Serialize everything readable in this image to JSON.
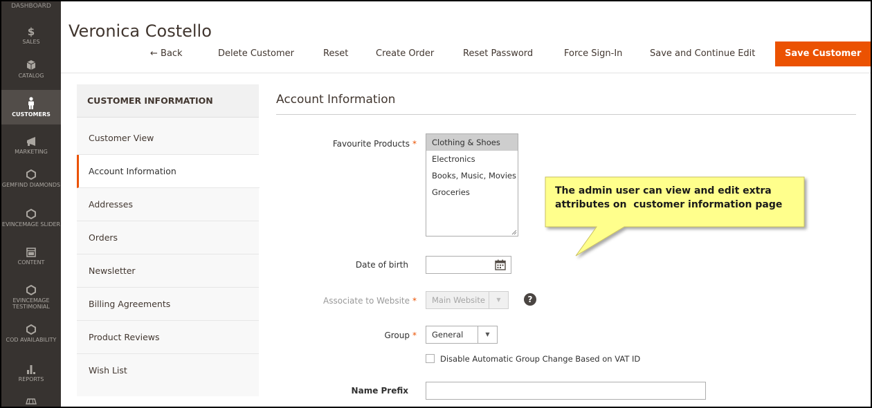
{
  "sidebar": {
    "top_label": "DASHBOARD",
    "items": [
      {
        "label": "SALES",
        "icon": "dollar-icon"
      },
      {
        "label": "CATALOG",
        "icon": "cube-icon"
      },
      {
        "label": "CUSTOMERS",
        "icon": "person-icon",
        "active": true
      },
      {
        "label": "MARKETING",
        "icon": "megaphone-icon"
      },
      {
        "label": "GEMFIND DIAMONDS",
        "icon": "hexagon-icon"
      },
      {
        "label": "EVINCEMAGE SLIDER",
        "icon": "hexagon-icon"
      },
      {
        "label": "CONTENT",
        "icon": "layout-icon"
      },
      {
        "label": "EVINCEMAGE TESTIMONIAL",
        "icon": "hexagon-icon"
      },
      {
        "label": "COD AVAILABILITY",
        "icon": "hexagon-icon"
      },
      {
        "label": "REPORTS",
        "icon": "bar-chart-icon"
      }
    ]
  },
  "header": {
    "title": "Veronica Costello",
    "actions": {
      "back": "← Back",
      "delete": "Delete Customer",
      "reset": "Reset",
      "create_order": "Create Order",
      "reset_password": "Reset Password",
      "force_signin": "Force Sign-In",
      "save_continue": "Save and Continue Edit",
      "save": "Save Customer"
    }
  },
  "tabs": {
    "title": "CUSTOMER INFORMATION",
    "items": [
      {
        "label": "Customer View"
      },
      {
        "label": "Account Information",
        "active": true
      },
      {
        "label": "Addresses"
      },
      {
        "label": "Orders"
      },
      {
        "label": "Newsletter"
      },
      {
        "label": "Billing Agreements"
      },
      {
        "label": "Product Reviews"
      },
      {
        "label": "Wish List"
      }
    ]
  },
  "section": {
    "title": "Account Information"
  },
  "form": {
    "favourite_products": {
      "label": "Favourite Products",
      "required_mark": "*",
      "options": [
        "Clothing & Shoes",
        "Electronics",
        "Books, Music, Movies",
        "Groceries"
      ],
      "selected": "Clothing & Shoes"
    },
    "dob": {
      "label": "Date of birth",
      "value": ""
    },
    "website": {
      "label": "Associate to Website",
      "required_mark": "*",
      "value": "Main Website",
      "help": "?"
    },
    "group": {
      "label": "Group",
      "required_mark": "*",
      "value": "General"
    },
    "vat": {
      "label": "Disable Automatic Group Change Based on VAT ID",
      "checked": false
    },
    "name_prefix": {
      "label": "Name Prefix",
      "value": ""
    }
  },
  "callout": {
    "line1": "The admin user can view and edit extra",
    "line2": "attributes on  customer information page",
    "color": "#ffff8c"
  },
  "colors": {
    "accent": "#eb5202",
    "sidebar": "#373330"
  }
}
